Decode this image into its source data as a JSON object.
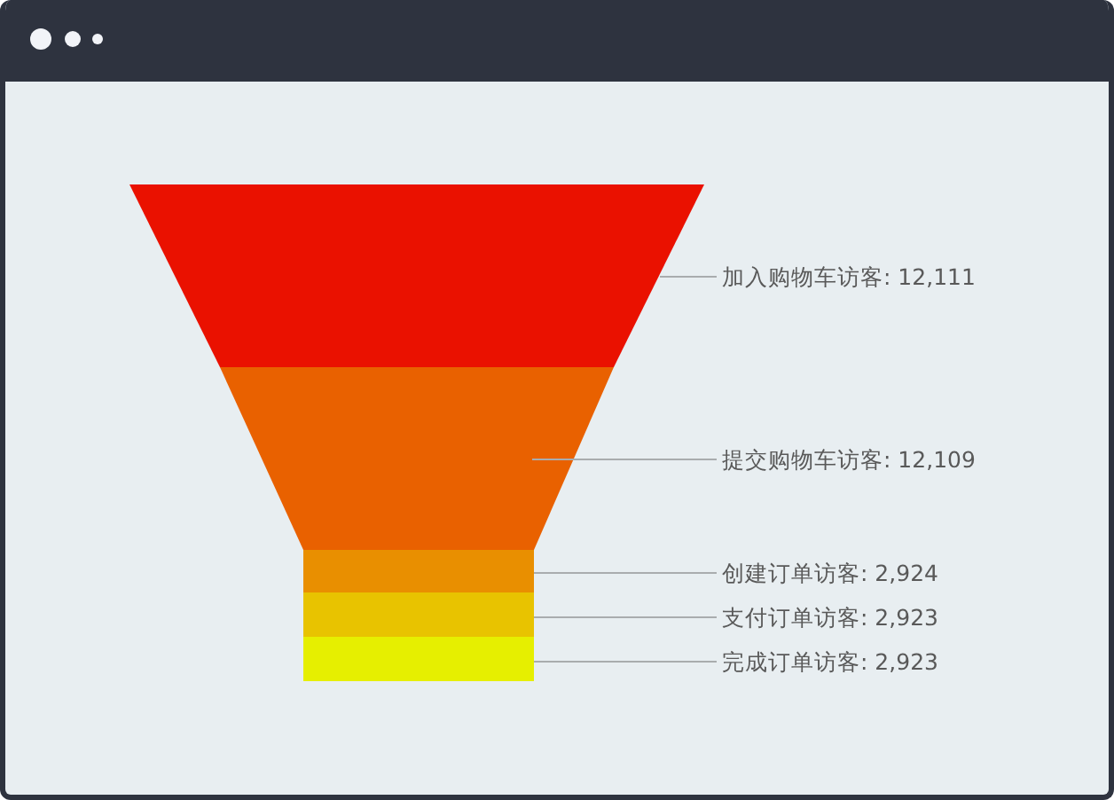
{
  "funnel": {
    "stages": [
      {
        "label": "加入购物车访客: 12,111",
        "color": "#ea1100"
      },
      {
        "label": "提交购物车访客: 12,109",
        "color": "#e96100"
      },
      {
        "label": "创建订单访客: 2,924",
        "color": "#e98f00"
      },
      {
        "label": "支付订单访客: 2,923",
        "color": "#e8c300"
      },
      {
        "label": "完成订单访客: 2,923",
        "color": "#e6ef00"
      }
    ]
  }
}
